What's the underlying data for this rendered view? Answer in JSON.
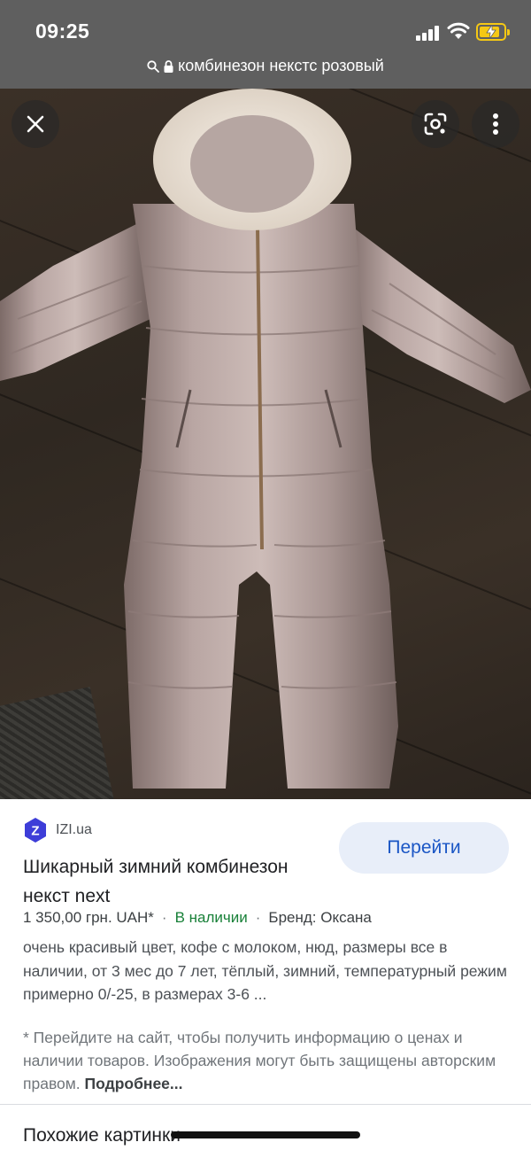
{
  "status_bar": {
    "time": "09:25"
  },
  "address_bar": {
    "query": "комбинезон некстс розовый"
  },
  "viewer": {
    "close_icon": "close-icon",
    "lens_icon": "google-lens-icon",
    "menu_icon": "more-vertical-icon"
  },
  "result": {
    "source_name": "IZI.ua",
    "source_logo_letter": "Z",
    "visit_label": "Перейти",
    "title": "Шикарный зимний комбинезон некст next",
    "price": "1 350,00 грн. UAH*",
    "separator": "·",
    "availability": "В наличии",
    "brand": "Бренд: Оксана",
    "description": "очень красивый цвет, кофе с молоком, нюд, размеры все в наличии, от 3 мес до 7 лет, тёплый, зимний, температурный режим примерно 0/-25, в размерах 3-6 ...",
    "notice": "* Перейдите на сайт, чтобы получить информацию о ценах и наличии товаров. Изображения могут быть защищены авторским правом.",
    "more_link": "Подробнее..."
  },
  "similar_heading": "Похожие картинки",
  "colors": {
    "accent": "#1a56c5",
    "in_stock": "#188038",
    "logo_bg": "#3d3dd8"
  }
}
